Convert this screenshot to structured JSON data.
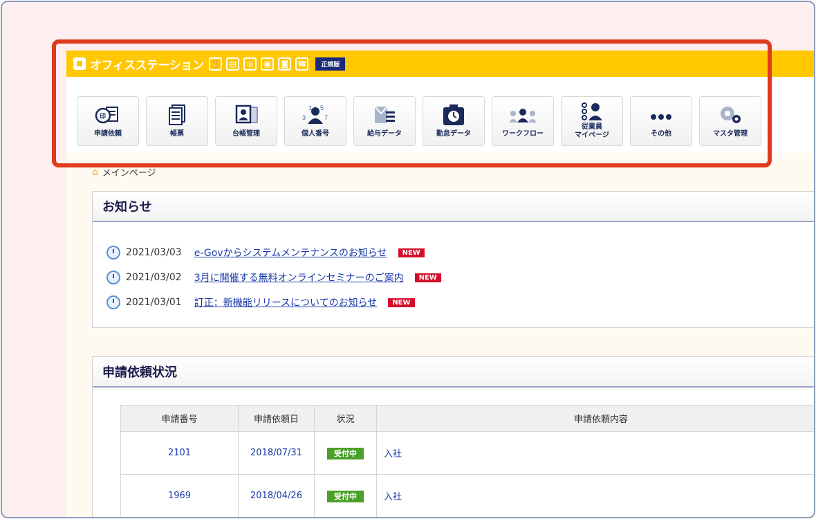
{
  "app": {
    "title": "オフィスステーション",
    "version_badge": "正規版"
  },
  "toolbar": {
    "buttons": [
      {
        "label": "申請依頼",
        "icon": "stamp-document-icon"
      },
      {
        "label": "帳票",
        "icon": "documents-icon"
      },
      {
        "label": "台帳管理",
        "icon": "ledger-card-icon"
      },
      {
        "label": "個人番号",
        "icon": "person-number-icon"
      },
      {
        "label": "給与データ",
        "icon": "payroll-mail-icon"
      },
      {
        "label": "勤怠データ",
        "icon": "attendance-clock-icon"
      },
      {
        "label": "ワークフロー",
        "icon": "workflow-people-icon"
      },
      {
        "label": "従業員\nマイページ",
        "icon": "employee-mypage-icon"
      },
      {
        "label": "その他",
        "icon": "more-dots-icon"
      },
      {
        "label": "マスタ管理",
        "icon": "gears-icon"
      }
    ]
  },
  "breadcrumb": {
    "label": "メインページ"
  },
  "news": {
    "title": "お知らせ",
    "new_label": "NEW",
    "items": [
      {
        "date": "2021/03/03",
        "text": "e-Govからシステムメンテナンスのお知らせ"
      },
      {
        "date": "2021/03/02",
        "text": "3月に開催する無料オンラインセミナーのご案内"
      },
      {
        "date": "2021/03/01",
        "text": "訂正：新機能リリースについてのお知らせ"
      }
    ]
  },
  "requests": {
    "title": "申請依頼状況",
    "columns": [
      "申請番号",
      "申請依頼日",
      "状況",
      "申請依頼内容"
    ],
    "rows": [
      {
        "number": "2101",
        "date": "2018/07/31",
        "status": "受付中",
        "content": "入社"
      },
      {
        "number": "1969",
        "date": "2018/04/26",
        "status": "受付中",
        "content": "入社"
      }
    ]
  },
  "colors": {
    "topbar": "#ffc800",
    "highlight": "#e03a1e",
    "new_badge": "#d0102a",
    "status_badge": "#4aa02a"
  }
}
